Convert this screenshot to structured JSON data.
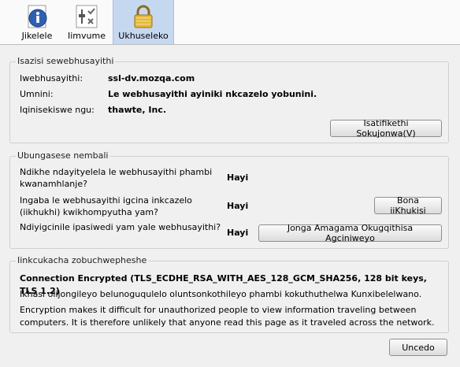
{
  "toolbar": {
    "items": [
      {
        "label": "Jikelele",
        "icon": "info-icon"
      },
      {
        "label": "Iimvume",
        "icon": "permissions-icon"
      },
      {
        "label": "Ukhuseleko",
        "icon": "lock-icon"
      }
    ]
  },
  "identity": {
    "title": "Isazisi sewebhusayithi",
    "website_label": "Iwebhusayithi:",
    "website_value": "ssl-dv.mozqa.com",
    "owner_label": "Umnini:",
    "owner_value": "Le webhusayithi ayiniki nkcazelo yobunini.",
    "verifier_label": "Iqinisekiswe ngu:",
    "verifier_value": "thawte, Inc.",
    "view_cert_button": "Isatifikethi Sokujonwa(V)"
  },
  "privacy": {
    "title": "Ubungasese nembali",
    "q1": "Ndikhe ndayityelela le webhusayithi phambi kwanamhlanje?",
    "a1": "Hayi",
    "q2": "Ingaba le webhusayithi igcina inkcazelo (iikhukhi) kwikhompyutha yam?",
    "a2": "Hayi",
    "cookies_button": "Bona iiKhukisi",
    "q3": "Ndiyigcinile ipasiwedi yam yale webhusayithi?",
    "a3": "Hayi",
    "passwords_button": "Jonga Amagama Okugqithisa Agciniweyo"
  },
  "technical": {
    "title": "Iinkcukacha zobuchwepheshe",
    "headline": "Connection Encrypted (TLS_ECDHE_RSA_WITH_AES_128_GCM_SHA256, 128 bit keys, TLS 1.2)",
    "line1": "Ikhasi olijongileyo belunoguqulelo oluntsonkothileyo phambi kokuthuthelwa Kunxibelelwano.",
    "line2": "Encryption makes it difficult for unauthorized people to view information traveling between computers. It is therefore unlikely that anyone read this page as it traveled across the network."
  },
  "footer": {
    "close_button": "Uncedo"
  }
}
